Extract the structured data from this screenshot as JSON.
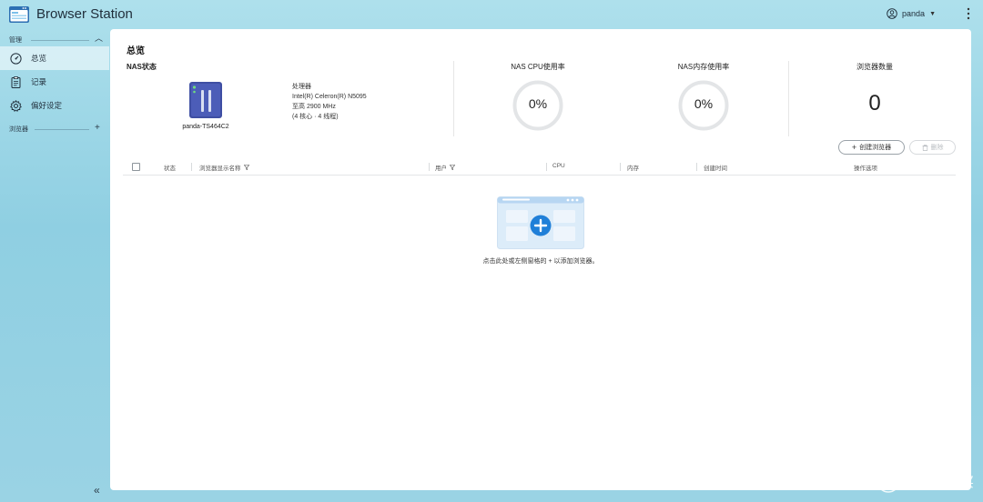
{
  "header": {
    "title": "Browser Station",
    "username": "panda"
  },
  "sidebar": {
    "sections": [
      {
        "label": "管理"
      },
      {
        "label": "浏览器"
      }
    ],
    "items": [
      {
        "label": "总览",
        "icon": "dashboard-icon"
      },
      {
        "label": "记录",
        "icon": "clipboard-icon"
      },
      {
        "label": "偏好设定",
        "icon": "gear-icon"
      }
    ],
    "add_symbol": "+",
    "collapse_symbol": "«"
  },
  "overview": {
    "title": "总览",
    "nas_status_label": "NAS状态",
    "device_name": "panda-TS464C2",
    "cpu": {
      "label": "处理器",
      "model": "Intel(R) Celeron(R) N5095",
      "freq": "至高 2900 MHz",
      "cores": "(4 核心 · 4 线程)"
    },
    "cpu_usage": {
      "label": "NAS CPU使用率",
      "value": "0%"
    },
    "mem_usage": {
      "label": "NAS内存使用率",
      "value": "0%"
    },
    "browser_count": {
      "label": "浏览器数量",
      "value": "0"
    }
  },
  "actions": {
    "create": "创建浏览器",
    "delete": "删除"
  },
  "table": {
    "columns": [
      "状态",
      "浏览器显示名称",
      "用户",
      "CPU",
      "内存",
      "创建时间",
      "操作选项"
    ]
  },
  "empty": {
    "message": "点击此处或左侧窗格的 + 以添加浏览器。"
  },
  "watermark": {
    "text": "什么值得买",
    "icon": "zhi-logo-icon"
  },
  "colors": {
    "accent": "#1f7fd8",
    "bg_top": "#aee0ec",
    "bg_bottom": "#8fcfe2"
  }
}
